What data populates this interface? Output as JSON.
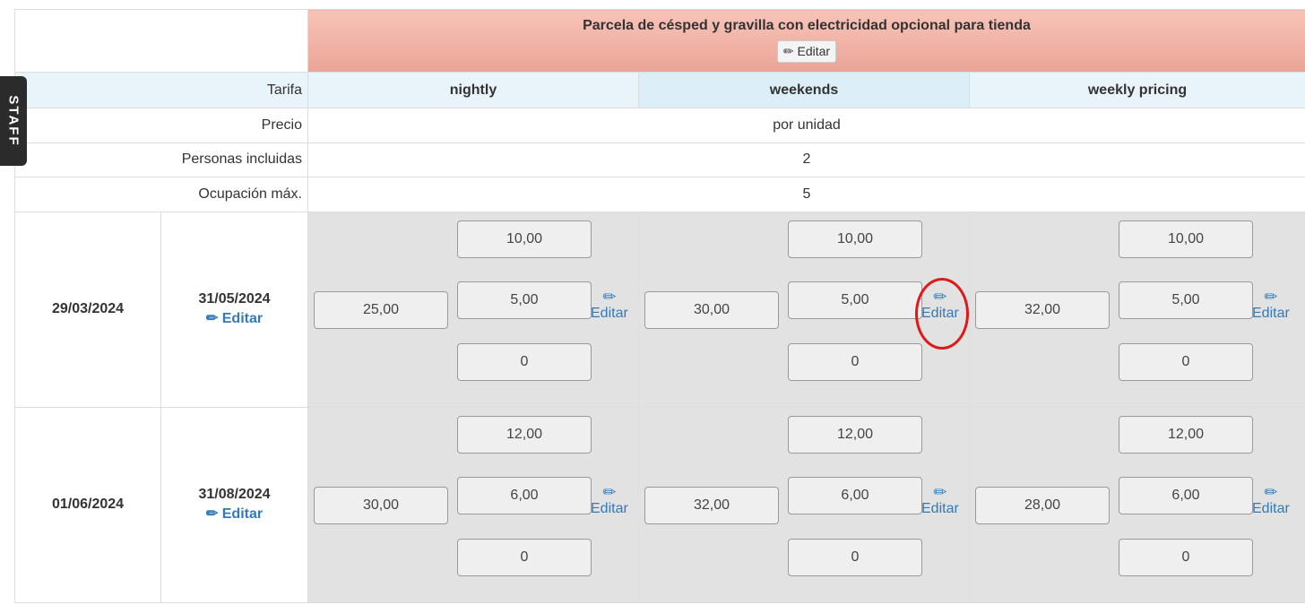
{
  "staff_tab": "STAFF",
  "lot": {
    "title": "Parcela de césped y gravilla con electricidad opcional para tienda",
    "edit_label": "Editar"
  },
  "labels": {
    "rate": "Tarifa",
    "price": "Precio",
    "persons": "Personas incluidas",
    "max": "Ocupación máx."
  },
  "rates": [
    "nightly",
    "weekends",
    "weekly pricing"
  ],
  "info": {
    "price_unit": "por unidad",
    "persons": "2",
    "max": "5"
  },
  "edit_label": "Editar",
  "pencil_icon": "✏",
  "periods": [
    {
      "start": "29/03/2024",
      "end": "31/05/2024",
      "edit": "Editar",
      "prices": [
        {
          "base": "25,00",
          "extra1": "10,00",
          "extra2": "5,00",
          "extra3": "0",
          "edit": "Editar"
        },
        {
          "base": "30,00",
          "extra1": "10,00",
          "extra2": "5,00",
          "extra3": "0",
          "edit": "Editar"
        },
        {
          "base": "32,00",
          "extra1": "10,00",
          "extra2": "5,00",
          "extra3": "0",
          "edit": "Editar"
        }
      ]
    },
    {
      "start": "01/06/2024",
      "end": "31/08/2024",
      "edit": "Editar",
      "prices": [
        {
          "base": "30,00",
          "extra1": "12,00",
          "extra2": "6,00",
          "extra3": "0",
          "edit": "Editar"
        },
        {
          "base": "32,00",
          "extra1": "12,00",
          "extra2": "6,00",
          "extra3": "0",
          "edit": "Editar"
        },
        {
          "base": "28,00",
          "extra1": "12,00",
          "extra2": "6,00",
          "extra3": "0",
          "edit": "Editar"
        }
      ]
    }
  ],
  "colors": {
    "header": "#f4b5a8",
    "link": "#337ab7",
    "highlight": "#e01818",
    "price_bg": "#e2e2e2"
  }
}
